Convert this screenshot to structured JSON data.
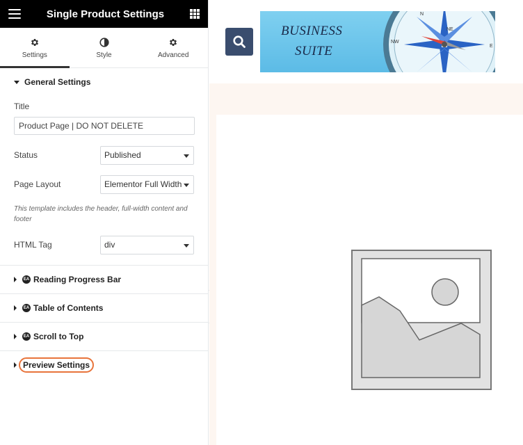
{
  "panel": {
    "title": "Single Product Settings",
    "tabs": [
      {
        "label": "Settings",
        "icon": "gear-icon",
        "active": true
      },
      {
        "label": "Style",
        "icon": "half-circle-icon",
        "active": false
      },
      {
        "label": "Advanced",
        "icon": "gear-icon",
        "active": false
      }
    ],
    "general": {
      "heading": "General Settings",
      "title_label": "Title",
      "title_value": "Product Page | DO NOT DELETE",
      "status_label": "Status",
      "status_value": "Published",
      "layout_label": "Page Layout",
      "layout_value": "Elementor Full Width",
      "layout_note": "This template includes the header, full-width content and footer",
      "html_tag_label": "HTML Tag",
      "html_tag_value": "div"
    },
    "sections": [
      {
        "label": "Reading Progress Bar",
        "badge": "EA"
      },
      {
        "label": "Table of Contents",
        "badge": "EA"
      },
      {
        "label": "Scroll to Top",
        "badge": "EA"
      },
      {
        "label": "Preview Settings"
      }
    ]
  },
  "preview": {
    "banner_line1": "BUSINESS",
    "banner_line2": "SUITE",
    "compass_labels": [
      "N",
      "NW",
      "NE",
      "E"
    ]
  },
  "colors": {
    "highlight": "#e8743b",
    "search_button": "#3a4d6e",
    "preview_bg": "#fdf6f1"
  }
}
